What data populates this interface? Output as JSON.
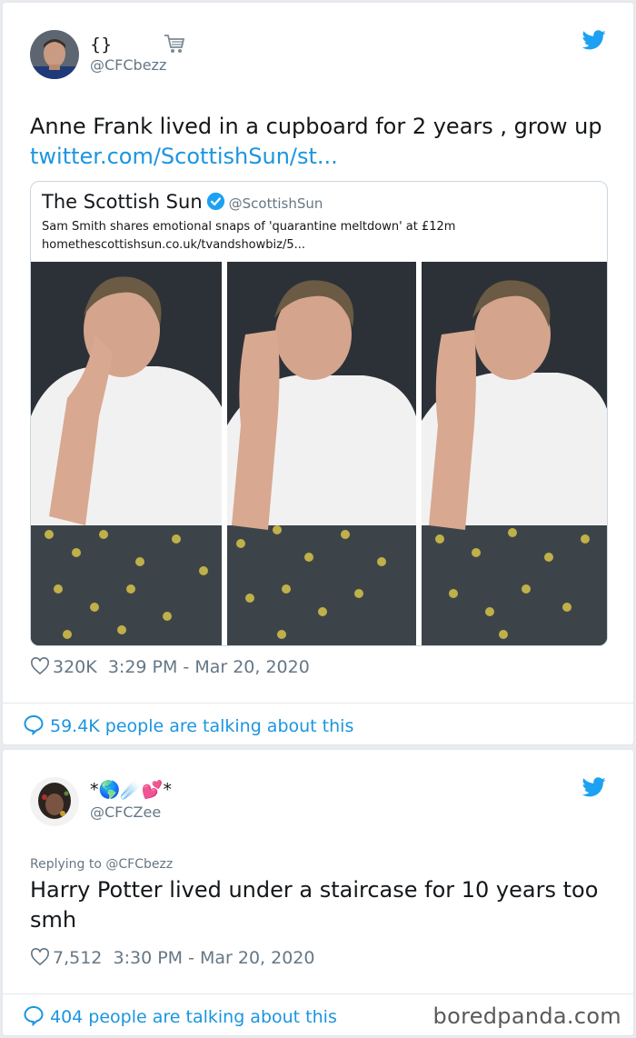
{
  "tweets": [
    {
      "display_name": "{}",
      "handle": "@CFCbezz",
      "text": "Anne Frank lived in a cupboard for 2 years , grow up",
      "link": "twitter.com/ScottishSun/st...",
      "quote": {
        "name": "The Scottish Sun",
        "handle": "@ScottishSun",
        "headline": "Sam Smith shares emotional snaps of 'quarantine meltdown' at £12m",
        "url": "homethescottishsun.co.uk/tvandshowbiz/5..."
      },
      "likes": "320K",
      "timestamp": "3:29 PM - Mar 20, 2020",
      "talking": "59.4K people are talking about this"
    },
    {
      "display_name": "*🌎☄️💕*",
      "handle": "@CFCZee",
      "replying_to": "Replying to @CFCbezz",
      "text": "Harry Potter lived under a staircase for 10 years too smh",
      "likes": "7,512",
      "timestamp": "3:30 PM - Mar 20, 2020",
      "talking": "404 people are talking about this"
    }
  ],
  "watermark": "boredpanda.com",
  "colors": {
    "link": "#1b95e0",
    "muted": "#657786",
    "verified": "#1da1f2"
  },
  "icons": [
    "twitter-bird-icon",
    "verified-badge-icon",
    "heart-icon",
    "comment-bubble-icon",
    "shopping-cart-icon"
  ]
}
